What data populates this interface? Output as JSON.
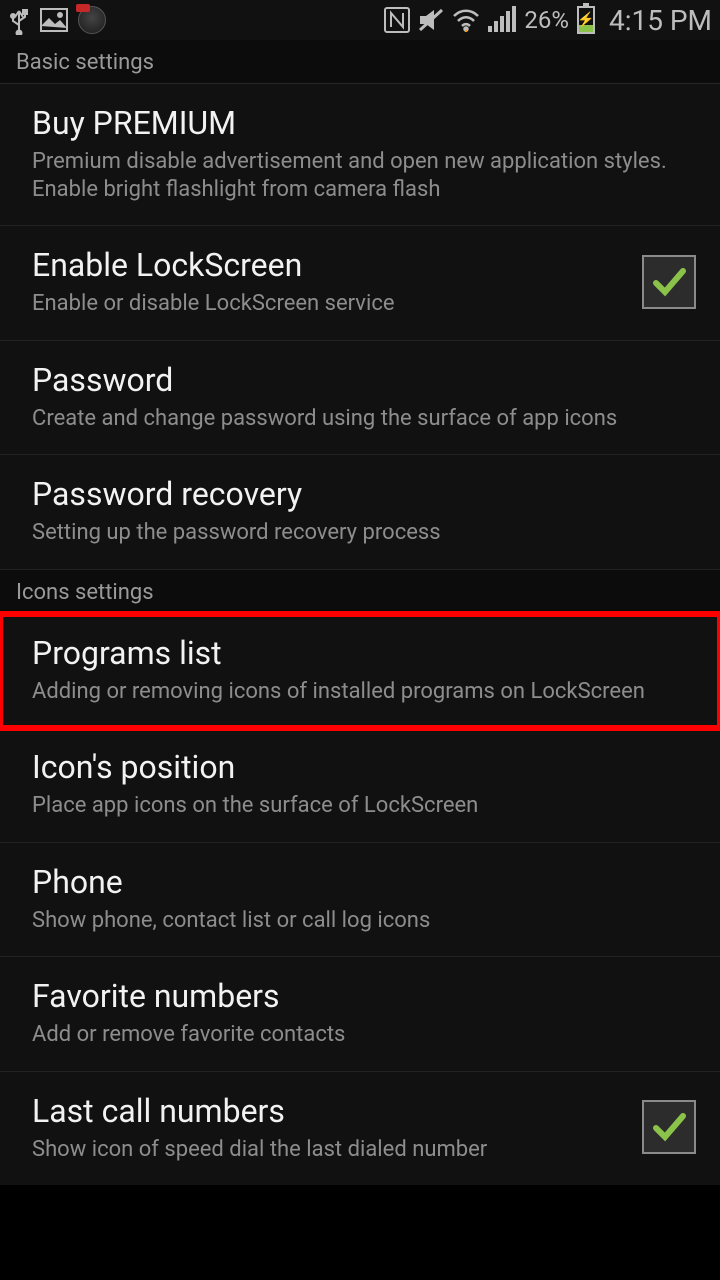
{
  "statusbar": {
    "battery_pct": "26%",
    "clock": "4:15 PM"
  },
  "sections": {
    "basic": {
      "header": "Basic settings"
    },
    "icons": {
      "header": "Icons settings"
    }
  },
  "items": {
    "buy_premium": {
      "title": "Buy PREMIUM",
      "desc": "Premium disable advertisement and open new application styles. Enable bright flashlight from camera flash"
    },
    "enable_lockscreen": {
      "title": "Enable LockScreen",
      "desc": "Enable or disable LockScreen service",
      "checked": true
    },
    "password": {
      "title": "Password",
      "desc": "Create and change password using the surface of app icons"
    },
    "password_recovery": {
      "title": "Password recovery",
      "desc": "Setting up the password recovery process"
    },
    "programs_list": {
      "title": "Programs list",
      "desc": "Adding or removing icons of installed programs on LockScreen",
      "highlighted": true
    },
    "icons_position": {
      "title": "Icon's position",
      "desc": "Place app icons on the surface of LockScreen"
    },
    "phone": {
      "title": "Phone",
      "desc": "Show phone, contact list or call log icons"
    },
    "favorite_numbers": {
      "title": "Favorite numbers",
      "desc": "Add or remove favorite contacts"
    },
    "last_call_numbers": {
      "title": "Last call numbers",
      "desc": "Show icon of speed dial the last dialed number",
      "checked": true
    }
  }
}
